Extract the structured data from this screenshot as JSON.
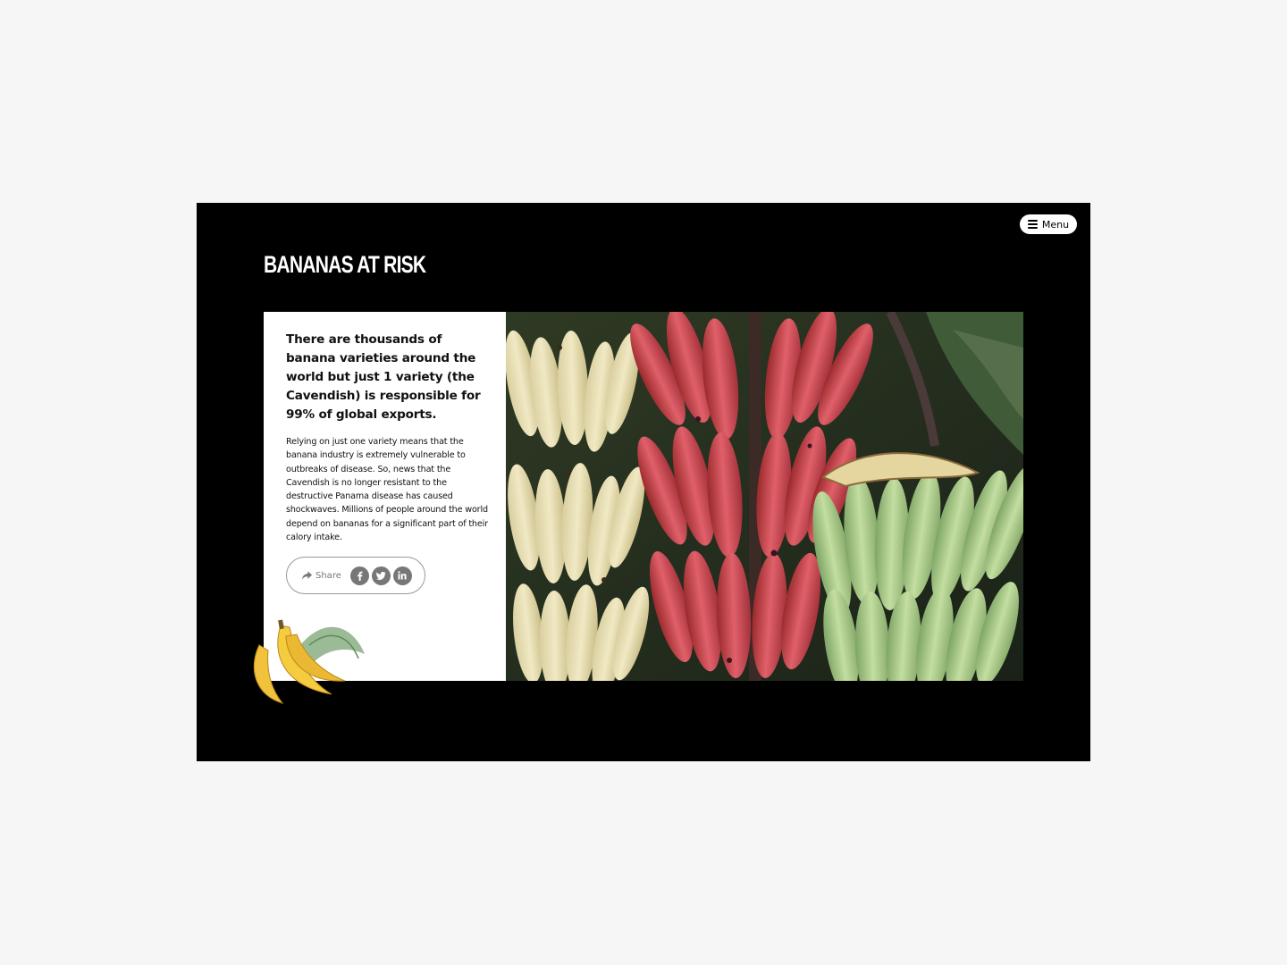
{
  "header": {
    "menu_label": "Menu",
    "page_title": "BANANAS AT RISK"
  },
  "article": {
    "headline": "There are thousands of banana varieties around the world but just 1 variety (the Cavendish) is responsible for 99% of global exports.",
    "body": "Relying on just one variety means that the banana industry is extremely vulnerable to outbreaks of disease. So, news that the Cavendish is no longer resistant to the destructive Panama disease has caused shockwaves. Millions of people around the world depend on bananas for a significant part of their calory intake."
  },
  "share": {
    "label": "Share",
    "networks": [
      "facebook",
      "twitter",
      "linkedin"
    ],
    "icon": "share-arrow-icon"
  },
  "colors": {
    "frame_background": "#000000",
    "page_background": "#f6f6f6",
    "panel_background": "#ffffff",
    "social_icon": "#777777"
  }
}
